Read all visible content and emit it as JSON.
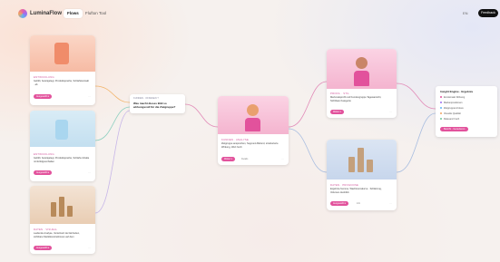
{
  "header": {
    "brand": "LuminaFlow",
    "tabs": [
      {
        "label": "Flows",
        "active": true
      },
      {
        "label": "Flufton Tool",
        "active": false
      }
    ],
    "lang": "EN",
    "feedback_label": "Feedback"
  },
  "colors": {
    "accent": "#e2529c",
    "tag": "#d2589c"
  },
  "cards": {
    "container1": {
      "tag": "ENTWICKLUNG",
      "desc": "Gefüllt, bereitgelegt, Produktsprache, Schärfekontakt · ab",
      "button": "Ausgewählt ▾"
    },
    "container2": {
      "tag": "ENTWICKLUNG",
      "desc": "Gefüllt, bereitgelegt, Produktsprache, Schärfe-Inhalte mit Erfolgsverhalten",
      "button": "Ausgewählt ▾"
    },
    "chart1": {
      "tag": "DATEN · VISUELL",
      "desc": "Laufende Analyse, Verteilnetz der Einheiten, sichtbare Marktkonstruktionen auf dem",
      "button": "Ausgewählt ▾"
    },
    "center": {
      "tag": "KUNDEN · ANALYSE",
      "desc": "Zielgruppe ansprechen, Segment-Befund, strukturierte Wirkung, Wert hoch",
      "button": "Weiter ▾",
      "sub": "Details"
    },
    "top_right": {
      "tag": "PROFIL · STIL",
      "desc": "Merkmalsprofil und Kundengruppe Tagesansicht, Sichtbare Kategorie",
      "button": "Weiter ▾"
    },
    "bottom_right": {
      "tag": "DATEN · PROGNOSE",
      "desc": "Ergebnis-Summe, Wachstumskurve · Schätzung, Volumen-Ausblick",
      "button": "Ausgewählt ▾",
      "sub": "Info"
    }
  },
  "question": {
    "label": "KUNDEN · OFFENEN ?",
    "text": "Was macht dieses Bild so wirkungsvoll für die Zielgruppe?"
  },
  "panel": {
    "title": "Insight Engine · Ergebnis",
    "rows": [
      {
        "label": "Emotionale Wirkung",
        "color": "#e2529c"
      },
      {
        "label": "Markenpositionen",
        "color": "#9b6cf0"
      },
      {
        "label": "Zielgruppen-Fokus",
        "color": "#5fb3f0"
      },
      {
        "label": "Visuelle Qualität",
        "color": "#f0a35f"
      },
      {
        "label": "Relevanz hoch",
        "color": "#6cc79a"
      }
    ],
    "button": "Bericht · Generieren"
  }
}
